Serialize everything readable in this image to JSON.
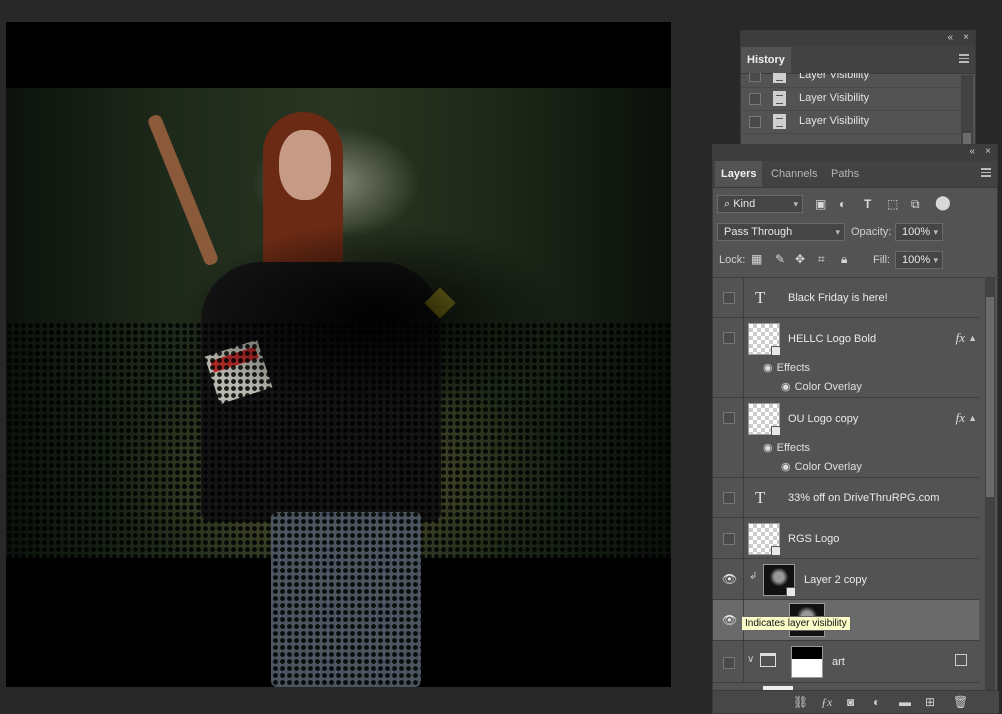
{
  "history_panel": {
    "collapse": "«",
    "close": "×",
    "tab": "History",
    "rows": [
      {
        "label": "Layer Visibility"
      },
      {
        "label": "Layer Visibility"
      },
      {
        "label": "Layer Visibility"
      }
    ]
  },
  "layers_panel": {
    "collapse": "«",
    "close": "×",
    "tabs": [
      "Layers",
      "Channels",
      "Paths"
    ],
    "filter": {
      "value": "Kind"
    },
    "blend_mode": "Pass Through",
    "opacity_label": "Opacity:",
    "opacity_value": "100%",
    "lock_label": "Lock:",
    "fill_label": "Fill:",
    "fill_value": "100%",
    "layers": [
      {
        "name": "Black Friday is here!",
        "type": "text"
      },
      {
        "name": "HELLC Logo Bold",
        "type": "smart",
        "fx": "fx",
        "effects_label": "Effects",
        "effect": "Color Overlay"
      },
      {
        "name": "OU Logo copy",
        "type": "smart",
        "fx": "fx",
        "effects_label": "Effects",
        "effect": "Color Overlay"
      },
      {
        "name": "33% off on DriveThruRPG.com",
        "type": "text"
      },
      {
        "name": "RGS Logo",
        "type": "smart"
      },
      {
        "name": "Layer 2 copy",
        "type": "image",
        "visible": true
      },
      {
        "name": "",
        "type": "mask",
        "visible": true,
        "selected": true
      },
      {
        "name": "art",
        "type": "group"
      }
    ],
    "tooltip": "Indicates layer visibility",
    "text_layer_glyph": "T"
  },
  "canvas": {
    "sign_text": "END"
  }
}
